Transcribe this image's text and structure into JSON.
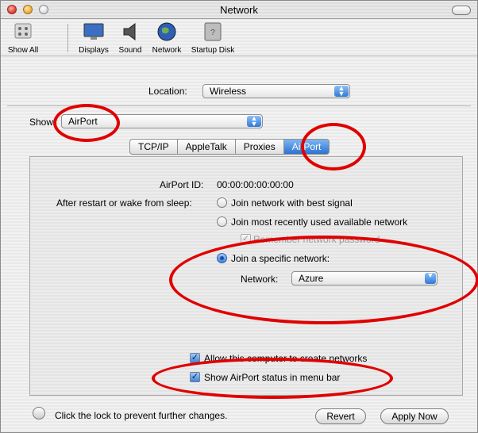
{
  "window": {
    "title": "Network"
  },
  "toolbar": {
    "items": [
      {
        "label": "Show All",
        "icon": "apple-grid-icon"
      },
      {
        "label": "Displays",
        "icon": "display-icon"
      },
      {
        "label": "Sound",
        "icon": "speaker-icon"
      },
      {
        "label": "Network",
        "icon": "globe-icon"
      },
      {
        "label": "Startup Disk",
        "icon": "disk-icon"
      }
    ]
  },
  "location": {
    "label": "Location:",
    "value": "Wireless"
  },
  "show": {
    "label": "Show",
    "value": "AirPort"
  },
  "tabs": [
    {
      "label": "TCP/IP"
    },
    {
      "label": "AppleTalk"
    },
    {
      "label": "Proxies"
    },
    {
      "label": "AirPort"
    }
  ],
  "airport": {
    "id_label": "AirPort ID:",
    "id_value": "00:00:00:00:00:00",
    "restart_label": "After restart or wake from sleep:",
    "options": [
      {
        "label": "Join network with best signal",
        "selected": false
      },
      {
        "label": "Join most recently used available network",
        "selected": false
      },
      {
        "label": "Join a specific network:",
        "selected": true
      }
    ],
    "remember_label": "Remember network password",
    "network_label": "Network:",
    "network_value": "Azure",
    "allow_create_label": "Allow this computer to create networks",
    "show_status_label": "Show AirPort status in menu bar"
  },
  "footer": {
    "lock_text": "Click the lock to prevent further changes.",
    "revert_label": "Revert",
    "apply_label": "Apply Now"
  },
  "colors": {
    "annotation": "#e00000",
    "accent": "#2c72d0"
  }
}
